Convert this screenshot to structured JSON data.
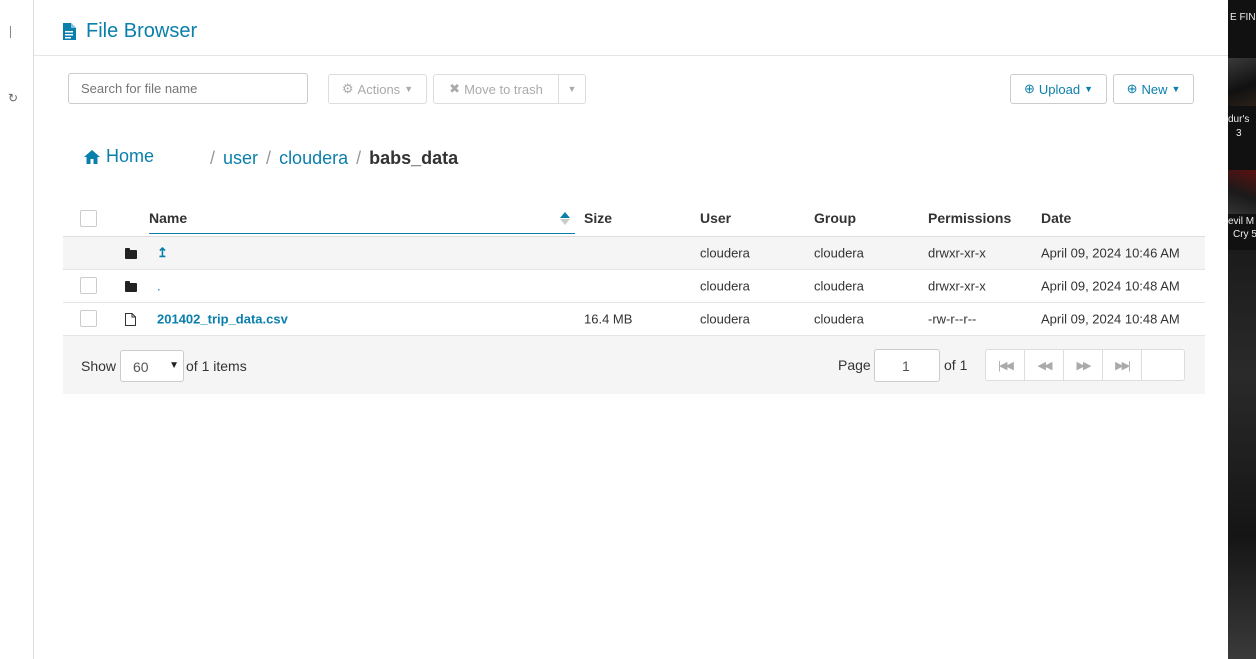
{
  "header": {
    "title": "File Browser"
  },
  "toolbar": {
    "search_placeholder": "Search for file name",
    "actions_label": "Actions",
    "trash_label": "Move to trash",
    "upload_label": "Upload",
    "new_label": "New"
  },
  "breadcrumb": {
    "home": "Home",
    "sep": "/",
    "crumbs": [
      "user",
      "cloudera"
    ],
    "current": "babs_data"
  },
  "table": {
    "columns": [
      "Name",
      "Size",
      "User",
      "Group",
      "Permissions",
      "Date"
    ],
    "rows": [
      {
        "icon": "folder-icon",
        "name": "↥",
        "size": "",
        "user": "cloudera",
        "group": "cloudera",
        "permissions": "drwxr-xr-x",
        "date": "April 09, 2024 10:46 AM"
      },
      {
        "icon": "folder-icon",
        "name": ".",
        "size": "",
        "user": "cloudera",
        "group": "cloudera",
        "permissions": "drwxr-xr-x",
        "date": "April 09, 2024 10:48 AM"
      },
      {
        "icon": "file-icon",
        "name": "201402_trip_data.csv",
        "size": "16.4 MB",
        "user": "cloudera",
        "group": "cloudera",
        "permissions": "-rw-r--r--",
        "date": "April 09, 2024 10:48 AM"
      }
    ]
  },
  "footer": {
    "show": "Show",
    "page_size": "60",
    "of_items": "of 1 items",
    "page_label": "Page",
    "page_value": "1",
    "of_pages": "of 1"
  },
  "side_panel": {
    "t1": "E FIN",
    "t2": "dur's",
    "t3": "3",
    "t4": "evil M",
    "t5": "Cry 5"
  },
  "colors": {
    "accent": "#0b7fab",
    "footer_bg": "#f5f5f5",
    "side_bg": "#111111"
  }
}
